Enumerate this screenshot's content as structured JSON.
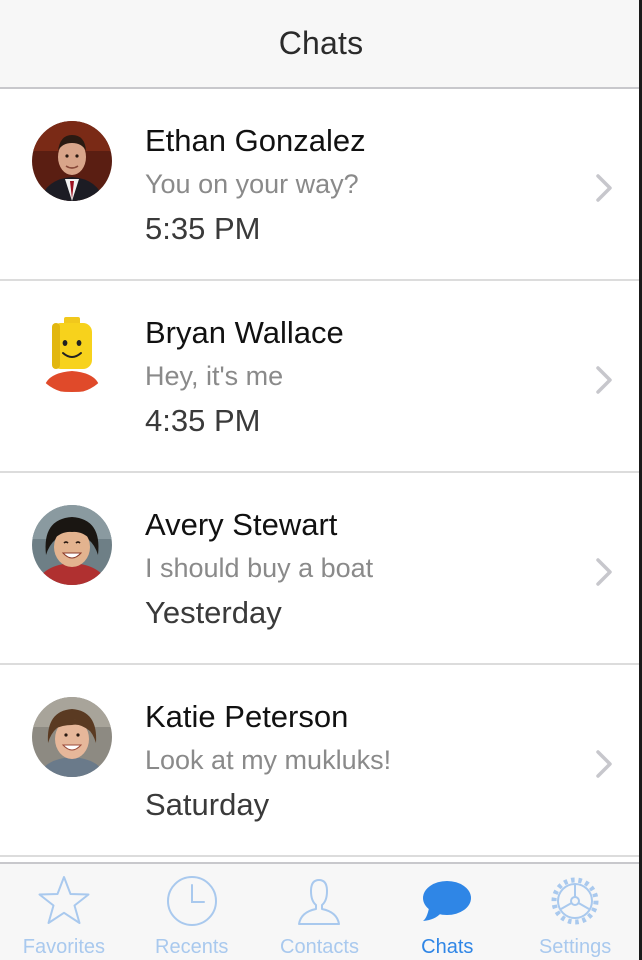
{
  "navbar": {
    "title": "Chats"
  },
  "chats": [
    {
      "name": "Ethan Gonzalez",
      "preview": "You on your way?",
      "time": "5:35 PM"
    },
    {
      "name": "Bryan Wallace",
      "preview": "Hey, it's me",
      "time": "4:35 PM"
    },
    {
      "name": "Avery Stewart",
      "preview": "I should buy a boat",
      "time": "Yesterday"
    },
    {
      "name": "Katie Peterson",
      "preview": "Look at my mukluks!",
      "time": "Saturday"
    }
  ],
  "tabs": [
    {
      "label": "Favorites",
      "icon": "star-icon"
    },
    {
      "label": "Recents",
      "icon": "clock-icon"
    },
    {
      "label": "Contacts",
      "icon": "person-icon"
    },
    {
      "label": "Chats",
      "icon": "chat-bubble-icon",
      "active": true
    },
    {
      "label": "Settings",
      "icon": "gear-icon"
    }
  ],
  "colors": {
    "accent": "#2f86e6",
    "inactive_tab": "#a9c9ee",
    "separator": "#dcdcdc"
  }
}
